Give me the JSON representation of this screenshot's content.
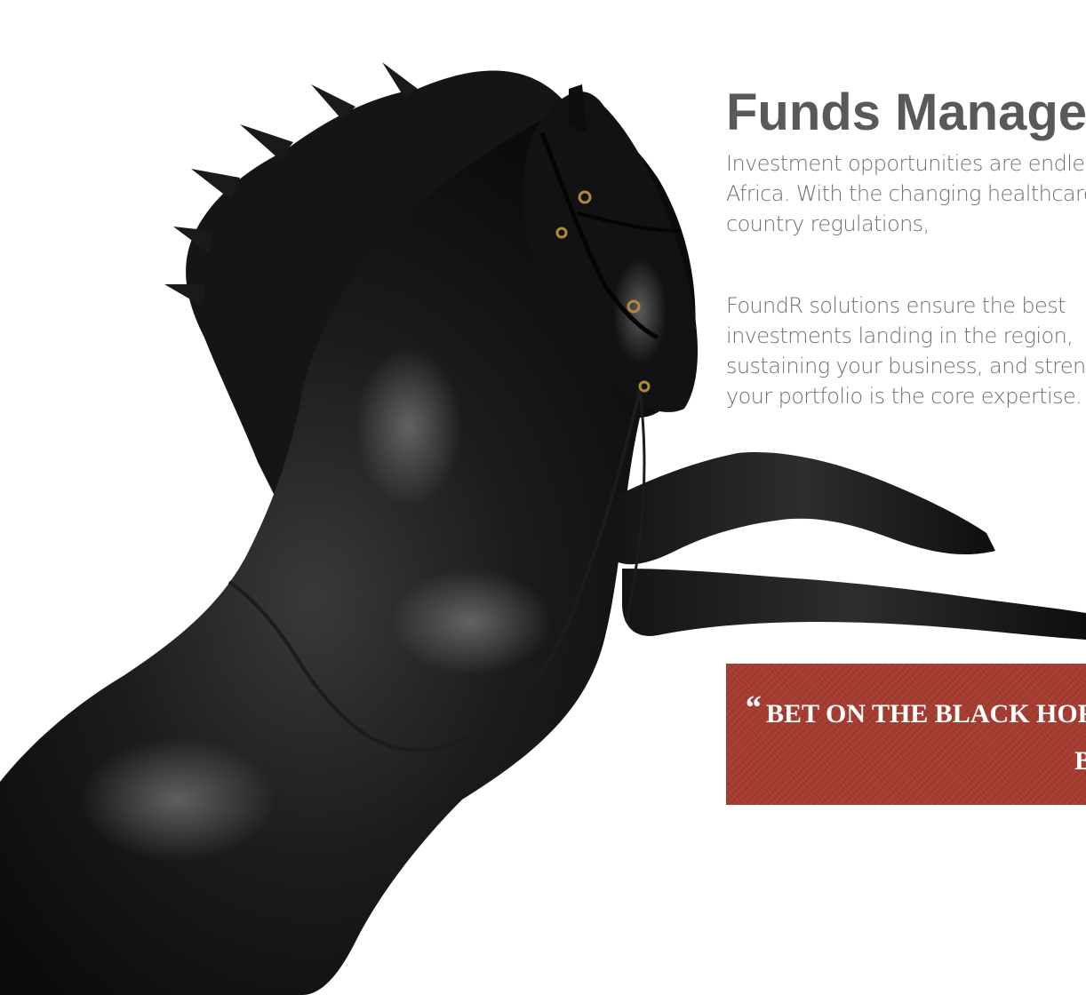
{
  "hero": {
    "image_label": "black rearing horse photograph"
  },
  "heading": {
    "title": "Funds Management"
  },
  "intro": {
    "line1": "Investment opportunities are endless in",
    "line2": "Africa. With the changing healthcare and",
    "line3": "country regulations,"
  },
  "solutions": {
    "line1": "FoundR solutions ensure the best",
    "line2": "investments landing in the region,",
    "line3": "sustaining your business, and strengthening",
    "line4": "your portfolio is the core expertise."
  },
  "quote": {
    "mark": "“",
    "line1": "BET ON THE BLACK HORSE",
    "line2": "B"
  },
  "colors": {
    "title": "#595959",
    "body_text": "#707070",
    "quote_bg": "#a63a2e",
    "quote_text": "#ffffff"
  }
}
